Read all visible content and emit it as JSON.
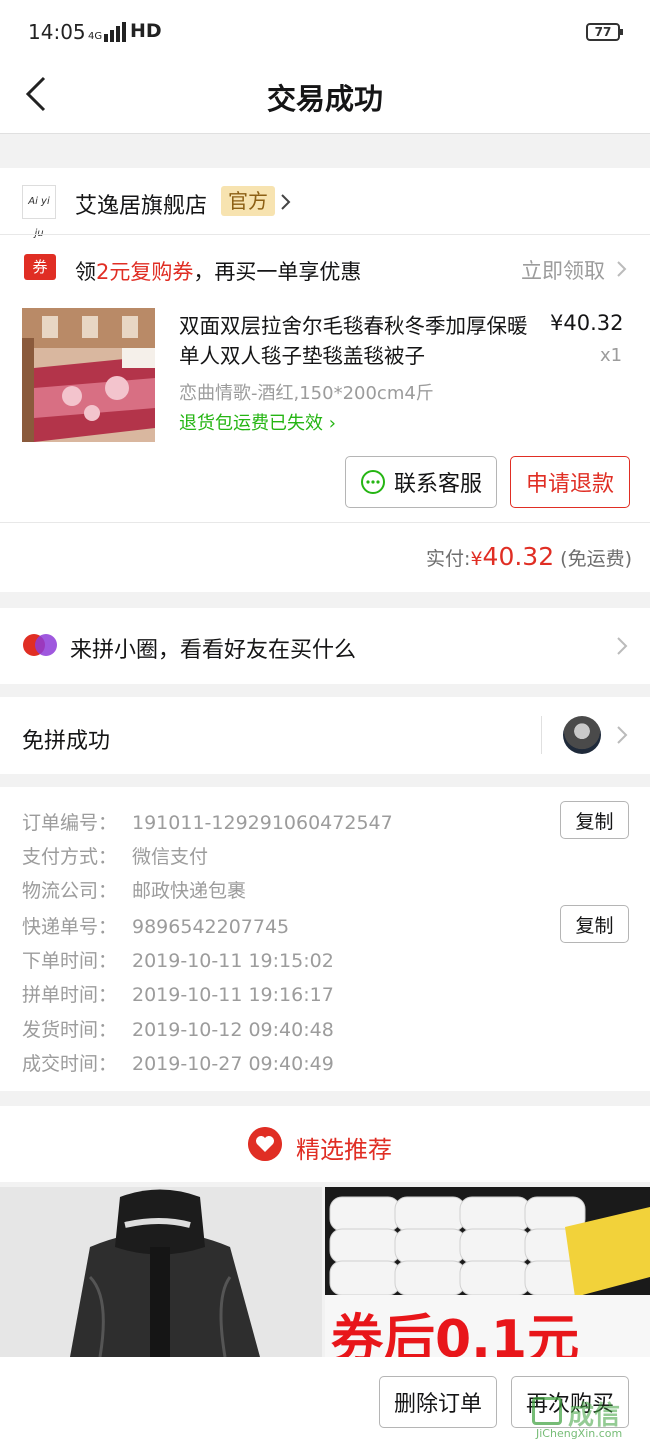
{
  "status": {
    "time": "14:05",
    "network": "4G",
    "hd": "HD",
    "battery": "77"
  },
  "nav": {
    "title": "交易成功"
  },
  "store": {
    "logo_text": "Ai yi ju",
    "name": "艾逸居旗舰店",
    "badge": "官方"
  },
  "coupon": {
    "icon": "券",
    "prefix": "领",
    "highlight": "2元复购券",
    "suffix": "，再买一单享优惠",
    "claim": "立即领取"
  },
  "product": {
    "title": "双面双层拉舍尔毛毯春秋冬季加厚保暖单人双人毯子垫毯盖毯被子",
    "price": "¥40.32",
    "qty": "x1",
    "spec": "恋曲情歌-酒红,150*200cm4斤",
    "return_note": "退货包运费已失效"
  },
  "actions": {
    "service": "联系客服",
    "refund": "申请退款"
  },
  "payment": {
    "label": "实付:",
    "currency": "¥",
    "amount": "40.32",
    "note": "(免运费)"
  },
  "circle": {
    "text": "来拼小圈，看看好友在买什么"
  },
  "group": {
    "text": "免拼成功"
  },
  "order_info": {
    "rows": [
      {
        "label": "订单编号：",
        "value": "191011-129291060472547"
      },
      {
        "label": "支付方式：",
        "value": "微信支付"
      },
      {
        "label": "物流公司：",
        "value": "邮政快递包裹"
      },
      {
        "label": "快递单号：",
        "value": "9896542207745"
      },
      {
        "label": "下单时间：",
        "value": "2019-10-11 19:15:02"
      },
      {
        "label": "拼单时间：",
        "value": "2019-10-11 19:16:17"
      },
      {
        "label": "发货时间：",
        "value": "2019-10-12 09:40:48"
      },
      {
        "label": "成交时间：",
        "value": "2019-10-27 09:40:49"
      }
    ],
    "copy_label": "复制"
  },
  "recommend": {
    "title": "精选推荐"
  },
  "tiles": {
    "t2_text": "券后0.1元"
  },
  "bottom": {
    "delete": "删除订单",
    "buy_again": "再次购买"
  },
  "watermark": {
    "cn": "成信",
    "en": "JiChengXin.com"
  },
  "colors": {
    "primary_red": "#e02e24",
    "green": "#25b513",
    "official_bg": "#f7e3b0",
    "gray_text": "#9c9c9c"
  }
}
